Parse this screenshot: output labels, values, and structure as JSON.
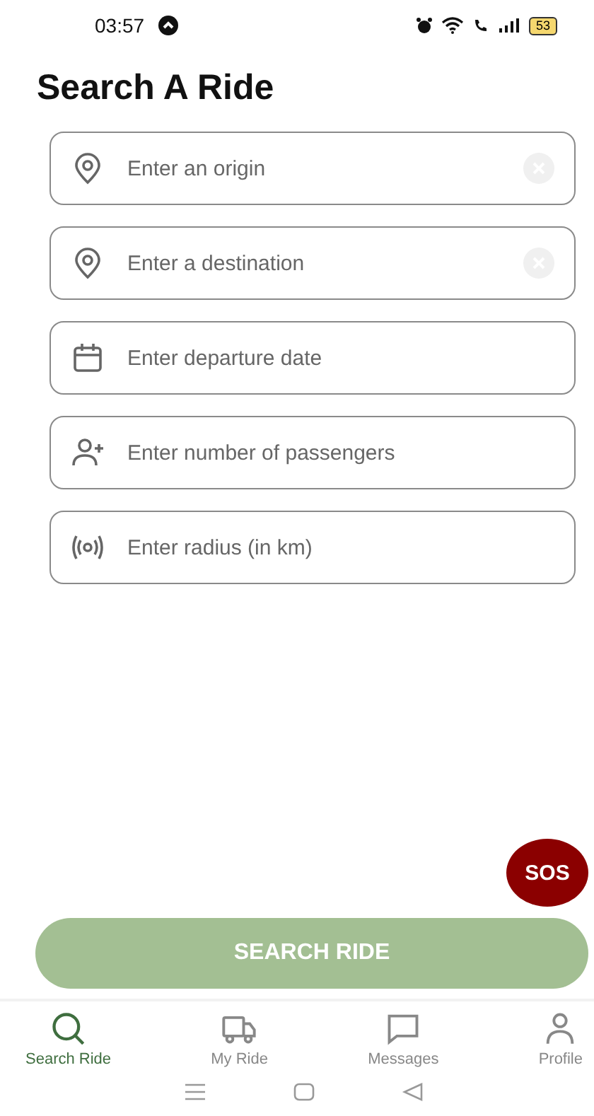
{
  "status_bar": {
    "time": "03:57",
    "battery": "53"
  },
  "title": "Search A Ride",
  "fields": [
    {
      "kind": "pin",
      "placeholder": "Enter an origin",
      "clearable": true
    },
    {
      "kind": "pin",
      "placeholder": "Enter a destination",
      "clearable": true
    },
    {
      "kind": "calendar",
      "placeholder": "Enter departure date",
      "clearable": false
    },
    {
      "kind": "person-add",
      "placeholder": "Enter number of passengers",
      "clearable": false
    },
    {
      "kind": "radius",
      "placeholder": "Enter radius (in km)",
      "clearable": false
    }
  ],
  "sos_button": "SOS",
  "search_button": {
    "label": "SEARCH RIDE",
    "disabled": true
  },
  "tabs": [
    {
      "kind": "search",
      "label": "Search Ride",
      "selected": true
    },
    {
      "kind": "truck",
      "label": "My Ride",
      "selected": false
    },
    {
      "kind": "chat",
      "label": "Messages",
      "selected": false
    },
    {
      "kind": "person",
      "label": "Profile",
      "selected": false
    }
  ]
}
